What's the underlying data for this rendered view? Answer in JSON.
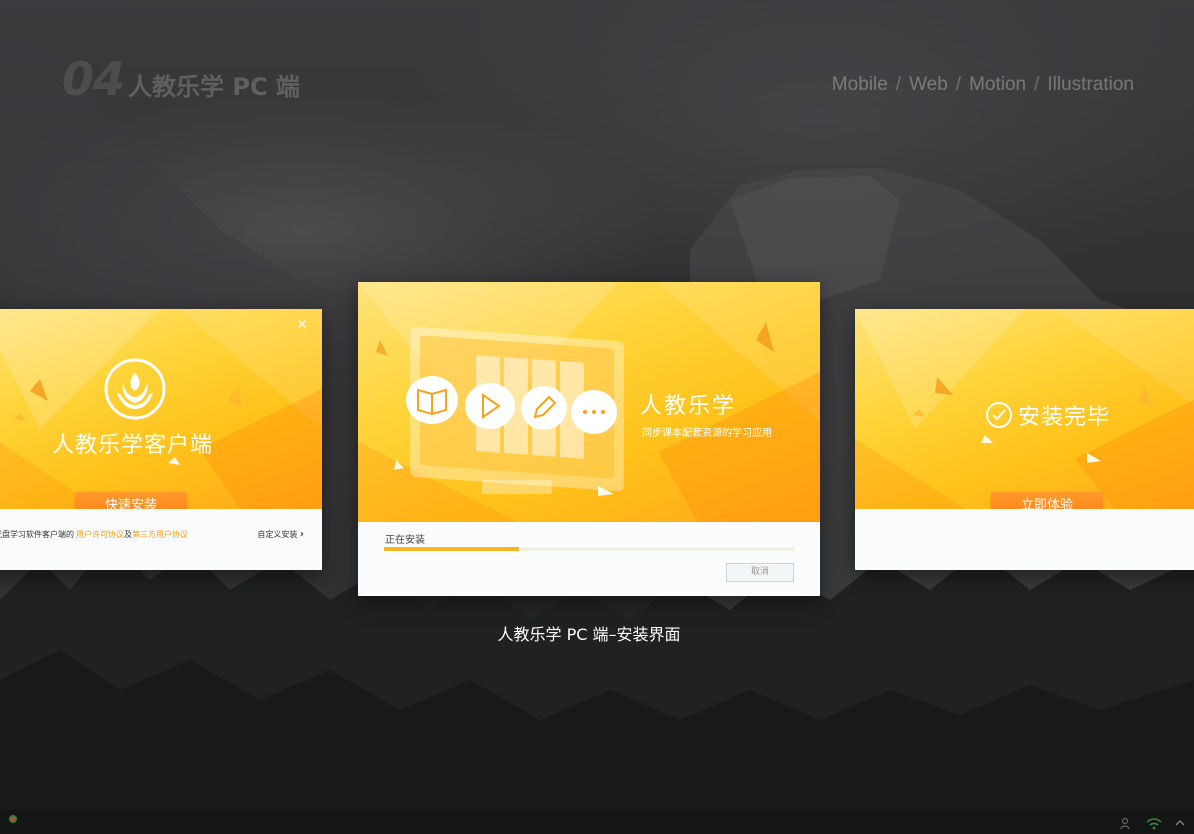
{
  "header": {
    "number": "04",
    "title": "人教乐学 PC 端",
    "nav": [
      "Mobile",
      "Web",
      "Motion",
      "Illustration"
    ],
    "separator": "/"
  },
  "left_card": {
    "close": "×",
    "title": "人教乐学客户端",
    "button": "快速安装",
    "agreement_prefix": "装套光盘学习软件客户端的",
    "agreement_link1": "用户许可协议",
    "agreement_mid": "及",
    "agreement_link2": "第三方用户协议",
    "custom_install": "自定义安装",
    "chevron": "›"
  },
  "center_card": {
    "app_name": "人教乐学",
    "subtitle": "同步课本配套资源的学习应用",
    "progress_label": "正在安装",
    "progress_fraction": 0.33,
    "cancel": "取消"
  },
  "right_card": {
    "done": "安装完毕",
    "button": "立即体验"
  },
  "caption": "人教乐学 PC 端–安装界面",
  "colors": {
    "accent_orange": "#ff8a1c",
    "hero_yellow": "#ffd43a",
    "progress": "#f5b623",
    "link": "#f2a01c"
  }
}
